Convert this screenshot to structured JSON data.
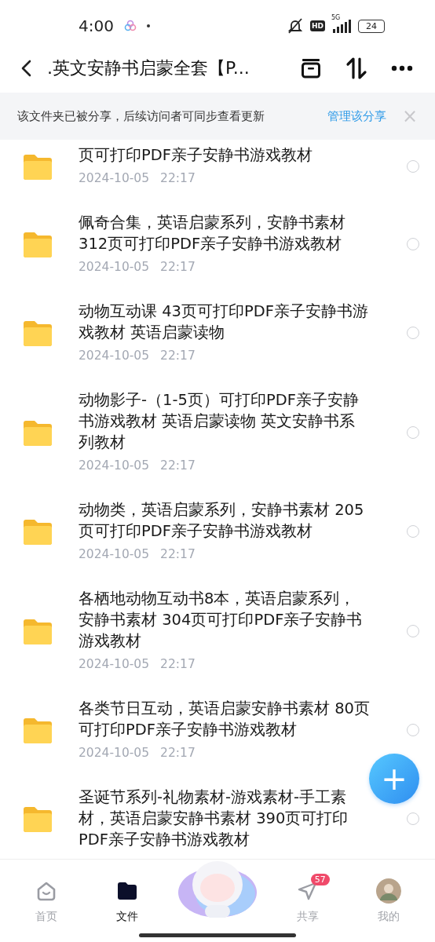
{
  "status_bar": {
    "time": "4:00",
    "hd": "HD",
    "network": "5G",
    "battery": "24"
  },
  "header": {
    "title": ".英文安静书启蒙全套【P..."
  },
  "share_banner": {
    "text": "该文件夹已被分享，后续访问者可同步查看更新",
    "link": "管理该分享",
    "close": "×"
  },
  "files": [
    {
      "name": "页可打印PDF亲子安静书游戏教材",
      "date": "2024-10-05",
      "time": "22:17",
      "checked": false
    },
    {
      "name": "佩奇合集，英语启蒙系列，安静书素材 312页可打印PDF亲子安静书游戏教材",
      "date": "2024-10-05",
      "time": "22:17",
      "checked": false
    },
    {
      "name": "动物互动课 43页可打印PDF亲子安静书游戏教材 英语启蒙读物",
      "date": "2024-10-05",
      "time": "22:17",
      "checked": false
    },
    {
      "name": "动物影子-（1-5页）可打印PDF亲子安静书游戏教材 英语启蒙读物 英文安静书系列教材",
      "date": "2024-10-05",
      "time": "22:17",
      "checked": false
    },
    {
      "name": "动物类，英语启蒙系列，安静书素材 205页可打印PDF亲子安静书游戏教材",
      "date": "2024-10-05",
      "time": "22:17",
      "checked": false
    },
    {
      "name": "各栖地动物互动书8本，英语启蒙系列，安静书素材 304页可打印PDF亲子安静书游戏教材",
      "date": "2024-10-05",
      "time": "22:17",
      "checked": false
    },
    {
      "name": "各类节日互动，英语启蒙安静书素材 80页可打印PDF亲子安静书游戏教材",
      "date": "2024-10-05",
      "time": "22:17",
      "checked": false
    },
    {
      "name": "圣诞节系列-礼物素材-游戏素材-手工素材，英语启蒙安静书素材 390页可打印PDF亲子安静书游戏教材",
      "checked": false
    }
  ],
  "fab": "+",
  "tab_bar": [
    {
      "kind": "home",
      "label": "首页",
      "selected": false
    },
    {
      "kind": "files",
      "label": "文件",
      "selected": true
    },
    {
      "kind": "mascot"
    },
    {
      "kind": "share",
      "label": "共享",
      "selected": false,
      "badge": "57"
    },
    {
      "kind": "me",
      "label": "我的",
      "selected": false
    }
  ]
}
